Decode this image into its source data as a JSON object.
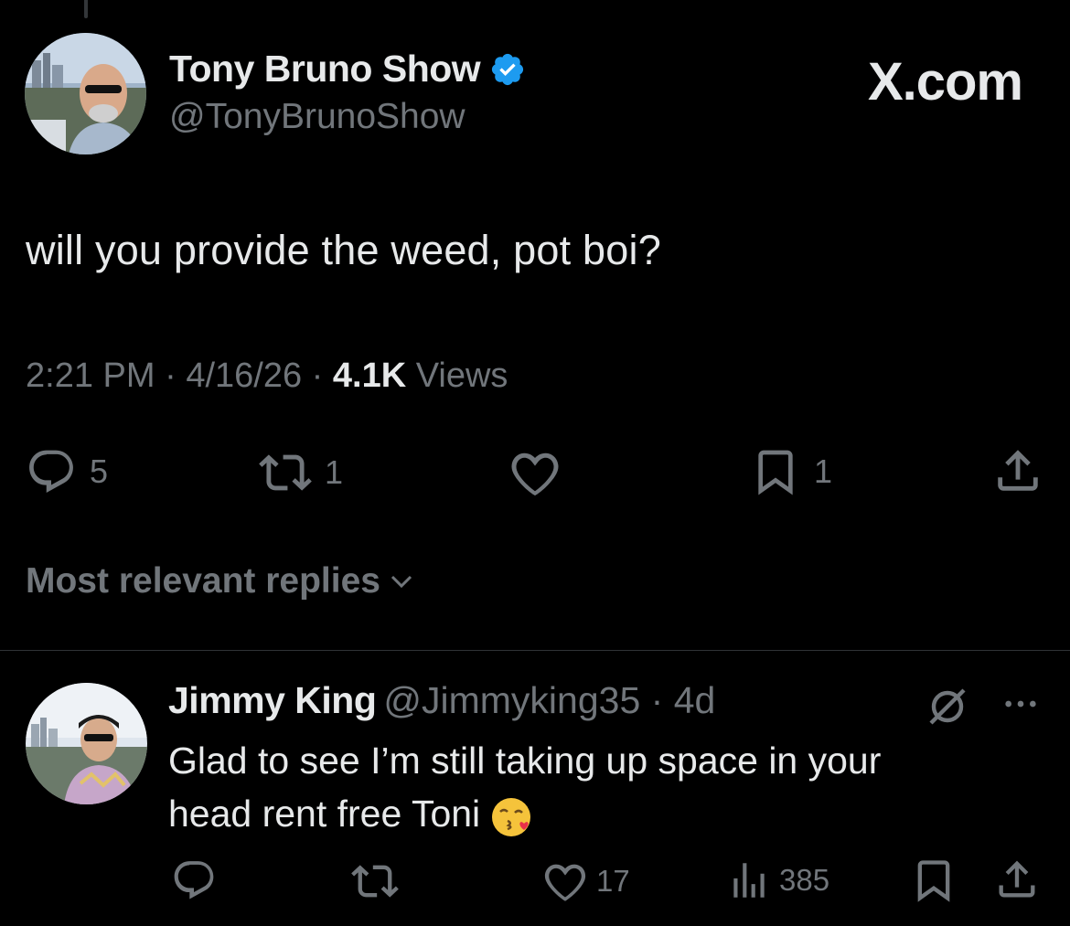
{
  "brand": "X.com",
  "tweet": {
    "author_name": "Tony Bruno Show",
    "author_handle": "@TonyBrunoShow",
    "text": "will you provide the weed, pot boi?",
    "time": "2:21 PM",
    "date": "4/16/26",
    "views_count": "4.1K",
    "views_label": "Views",
    "replies": "5",
    "reposts": "1",
    "bookmarks": "1",
    "icons": [
      "reply-icon",
      "repost-icon",
      "like-icon",
      "bookmark-icon",
      "share-icon"
    ]
  },
  "sort_label": "Most relevant replies",
  "reply": {
    "author_name": "Jimmy King",
    "author_handle": "@Jimmyking35",
    "age": "4d",
    "text_line1": "Glad to see I’m still taking up space in your",
    "text_line2": "head rent free Toni",
    "likes": "17",
    "views": "385",
    "icons": [
      "reply-icon",
      "repost-icon",
      "like-icon",
      "views-icon",
      "bookmark-icon",
      "share-icon",
      "grok-icon",
      "more-icon"
    ]
  },
  "colors": {
    "background": "#000000",
    "text": "#e7e9ea",
    "muted": "#71767b",
    "verified": "#1d9bf0",
    "divider": "#2f3336"
  }
}
